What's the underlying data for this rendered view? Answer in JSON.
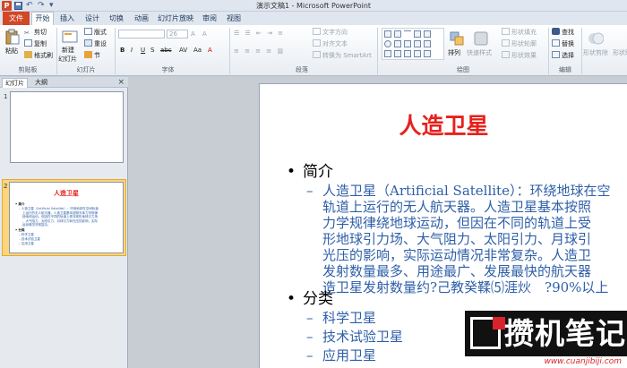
{
  "titlebar": {
    "app_icon": "P",
    "title": "演示文稿1 - Microsoft PowerPoint",
    "qat": {
      "save": "save-icon",
      "undo": "↶",
      "redo": "↷",
      "more": "▾"
    }
  },
  "tabs": [
    "文件",
    "开始",
    "插入",
    "设计",
    "切换",
    "动画",
    "幻灯片放映",
    "审阅",
    "视图"
  ],
  "ribbon": {
    "clipboard": {
      "paste": "粘贴",
      "cut": "剪切",
      "copy": "复制",
      "painter": "格式刷",
      "label": "剪贴板"
    },
    "slides": {
      "new_slide": "新建",
      "new_slide2": "幻灯片",
      "layout": "版式",
      "reset": "重设",
      "section": "节",
      "label": "幻灯片"
    },
    "font": {
      "size": "26",
      "label": "字体"
    },
    "paragraph": {
      "direction": "文字方向",
      "align": "对齐文本",
      "smartart": "转换为 SmartArt",
      "label": "段落"
    },
    "drawing": {
      "arrange": "排列",
      "quick_styles": "快速样式",
      "fill": "形状填充",
      "outline": "形状轮廓",
      "effects": "形状效果",
      "label": "绘图"
    },
    "editing": {
      "find": "查找",
      "replace": "替换",
      "select": "选择",
      "label": "编辑"
    },
    "extra": {
      "text1": "形状剪除",
      "text2": "形状联"
    }
  },
  "leftpane": {
    "tab_slides": "幻灯片",
    "tab_outline": "大纲",
    "close": "×",
    "thumb1_num": "1",
    "thumb2_num": "2",
    "thumb2": {
      "title": "人造卫星",
      "lines": [
        "• 简介",
        "– 人造卫星（Artificial Satellite）：环绕地球在空间轨道",
        "上运行的无人航天器。人造卫星基本按照天体力学规律",
        "绕地球运动，但因在不同的轨道上受非球形地球引力场",
        "、大气阻力、太阳引力、月球引力和光压的影响，实际",
        "运动情况非常复杂。",
        "• 分类",
        "– 科学卫星",
        "– 技术试验卫星",
        "– 应用卫星"
      ]
    }
  },
  "slide": {
    "title": "人造卫星",
    "bullet1": "简介",
    "intro_lines": [
      "人造卫星（Artificial Satellite）：环绕地球在空",
      "轨道上运行的无人航天器。人造卫星基本按照",
      "力学规律绕地球运动，但因在不同的轨道上受",
      "形地球引力场、大气阻力、太阳引力、月球引",
      "光压的影响，实际运动情况非常复杂。人造卫",
      "发射数量最多、用途最广、发展最快的航天器",
      "造卫星发射数量约?己教癸鞣⑸涯炏　?90%以上"
    ],
    "bullet2": "分类",
    "categories": [
      "科学卫星",
      "技术试验卫星",
      "应用卫星"
    ]
  },
  "watermark": {
    "text": "攒机笔记",
    "url": "www.cuanjibiji.com"
  },
  "colors": {
    "title_red": "#e8201b",
    "body_blue": "#2e5fa7",
    "file_tab": "#d24726"
  }
}
